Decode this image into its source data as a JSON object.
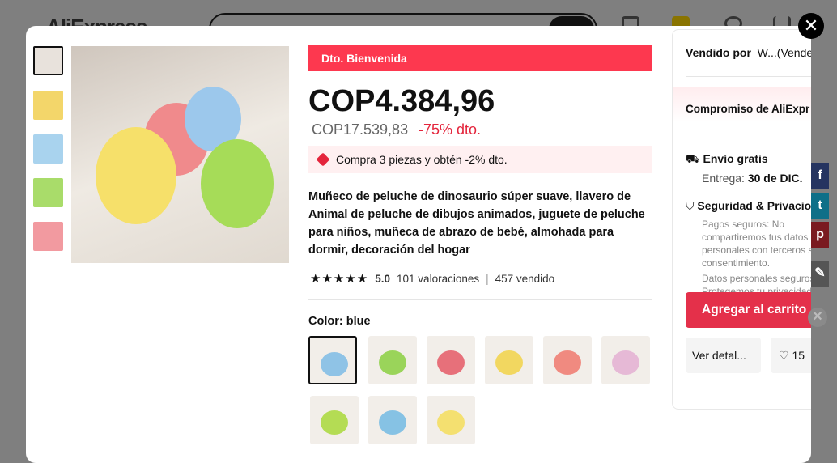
{
  "header": {
    "logo": "AliExpress",
    "cart_count": "0"
  },
  "gallery": {
    "thumb_count": 5
  },
  "product": {
    "promo_badge": "Dto. Bienvenida",
    "price": "COP4.384,96",
    "old_price": "COP17.539,83",
    "discount": "-75% dto.",
    "coupon": "Compra 3 piezas y obtén -2% dto.",
    "title": "Muñeco de peluche de dinosaurio súper suave, llavero de Animal de peluche de dibujos animados, juguete de peluche para niños, muñeca de abrazo de bebé, almohada para dormir, decoración del hogar",
    "rating": "5.0",
    "reviews": "101 valoraciones",
    "sold": "457 vendido",
    "color_label": "Color: blue",
    "swatch_colors": [
      "#8fc3e6",
      "#9ad45a",
      "#e7707a",
      "#f2d760",
      "#f08a80",
      "#e6b9d6",
      "#b4dc54",
      "#86c2e4",
      "#f4e070"
    ]
  },
  "sidebar": {
    "sold_by_label": "Vendido por",
    "sold_by_value": "W...(Vende",
    "commitment": "Compromiso de AliExpr",
    "shipping": "Envío gratis",
    "delivery_label": "Entrega:",
    "delivery_date": "30 de DIC.",
    "security": "Seguridad & Privacio",
    "security_text1": "Pagos seguros: No compartiremos tus datos personales con terceros s tu consentimiento.",
    "security_text2": "Datos personales seguros Protegemos tu privacidad mantenemos tus datos",
    "add_to_cart": "Agregar al carrito",
    "details": "Ver detal...",
    "wishlist_count": "15"
  },
  "colors": {
    "accent": "#fd384f",
    "cart": "#e4304a"
  }
}
